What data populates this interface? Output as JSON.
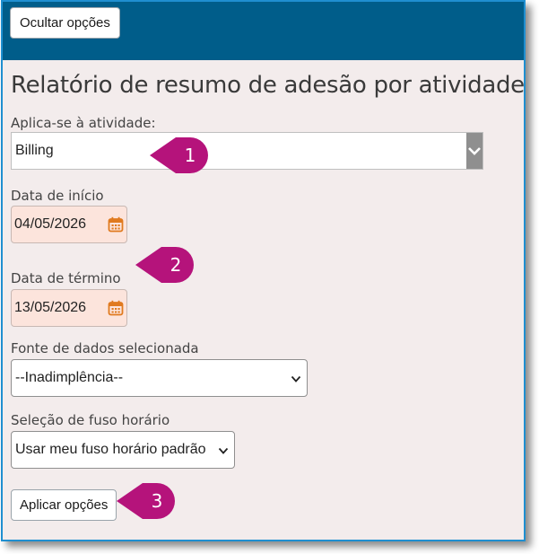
{
  "toolbar": {
    "hide_label": "Ocultar opções"
  },
  "page_title": "Relatório de resumo de adesão por atividade",
  "activity": {
    "label": "Aplica-se à atividade:",
    "value": "Billing"
  },
  "start_date": {
    "label": "Data de início",
    "value": "04/05/2026"
  },
  "end_date": {
    "label": "Data de término",
    "value": "13/05/2026"
  },
  "data_source": {
    "label": "Fonte de dados selecionada",
    "value": "--Inadimplência--"
  },
  "timezone": {
    "label": "Seleção de fuso horário",
    "value": "Usar meu fuso horário padrão"
  },
  "apply": {
    "label": "Aplicar opções"
  },
  "callouts": [
    "1",
    "2",
    "3"
  ],
  "colors": {
    "topbar": "#005d8a",
    "border": "#1f8fd0",
    "callout": "#b5137b",
    "date_bg": "#fce4dc",
    "calendar_icon": "#e07a1f"
  }
}
